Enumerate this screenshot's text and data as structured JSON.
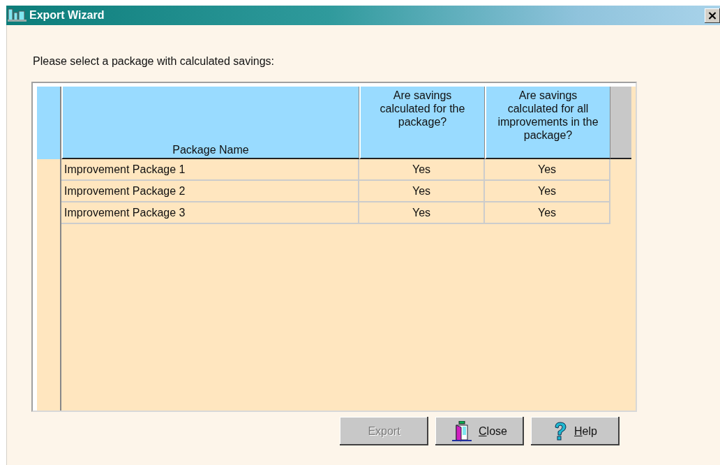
{
  "window": {
    "title": "Export Wizard",
    "close_label": "×"
  },
  "prompt": "Please select a package with calculated savings:",
  "table": {
    "columns": [
      "Package Name",
      "Are savings calculated for the package?",
      "Are savings calculated for all improvements in the package?"
    ],
    "rows": [
      {
        "cells": [
          "Improvement Package 1",
          "Yes",
          "Yes"
        ]
      },
      {
        "cells": [
          "Improvement Package 2",
          "Yes",
          "Yes"
        ]
      },
      {
        "cells": [
          "Improvement Package 3",
          "Yes",
          "Yes"
        ]
      }
    ]
  },
  "buttons": [
    {
      "label": "Export",
      "kind": "plain",
      "disabled": true,
      "underline_first": false
    },
    {
      "label": "Close",
      "kind": "door",
      "disabled": false,
      "underline_first": true
    },
    {
      "label": "Help",
      "kind": "help",
      "disabled": false,
      "underline_first": true
    }
  ]
}
